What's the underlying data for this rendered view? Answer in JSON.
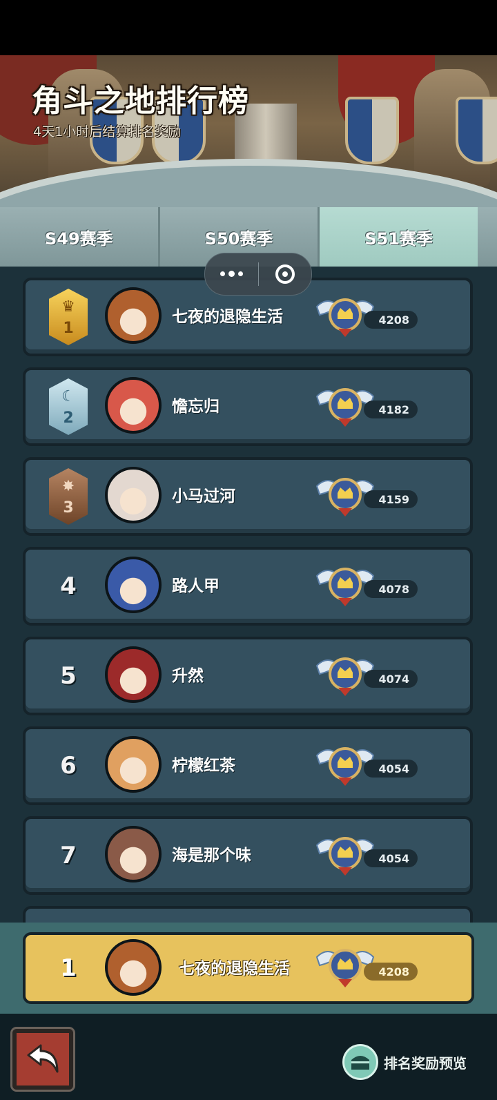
{
  "header": {
    "title": "角斗之地排行榜",
    "subtitle": "4天1小时后结算排名奖励"
  },
  "tabs": [
    {
      "label": "S49赛季",
      "active": false
    },
    {
      "label": "S50赛季",
      "active": false
    },
    {
      "label": "S51赛季",
      "active": true
    }
  ],
  "capsule": {
    "more_icon": "more-dots-icon",
    "close_icon": "target-close-icon"
  },
  "ranking": [
    {
      "rank": "1",
      "medal": "gold",
      "name": "七夜的退隐生活",
      "score": "4208",
      "avatar_color": "#b0602e"
    },
    {
      "rank": "2",
      "medal": "silver",
      "name": "憺忘归",
      "score": "4182",
      "avatar_color": "#d8584a"
    },
    {
      "rank": "3",
      "medal": "bronze",
      "name": "小马过河",
      "score": "4159",
      "avatar_color": "#e3d8d0"
    },
    {
      "rank": "4",
      "medal": "",
      "name": "路人甲",
      "score": "4078",
      "avatar_color": "#3a5aa8"
    },
    {
      "rank": "5",
      "medal": "",
      "name": "升然",
      "score": "4074",
      "avatar_color": "#9c2a2a"
    },
    {
      "rank": "6",
      "medal": "",
      "name": "柠檬红茶",
      "score": "4054",
      "avatar_color": "#e0a060"
    },
    {
      "rank": "7",
      "medal": "",
      "name": "海是那个味",
      "score": "4054",
      "avatar_color": "#8a5a48"
    }
  ],
  "my_rank": {
    "rank": "1",
    "name": "七夜的退隐生活",
    "score": "4208",
    "avatar_color": "#b0602e"
  },
  "footer": {
    "back_icon": "back-arrow-icon",
    "reward_preview_label": "排名奖励预览",
    "reward_icon": "chest-icon"
  },
  "colors": {
    "accent": "#9fcac0",
    "my_row": "#e7c25d",
    "row": "#34505f"
  }
}
